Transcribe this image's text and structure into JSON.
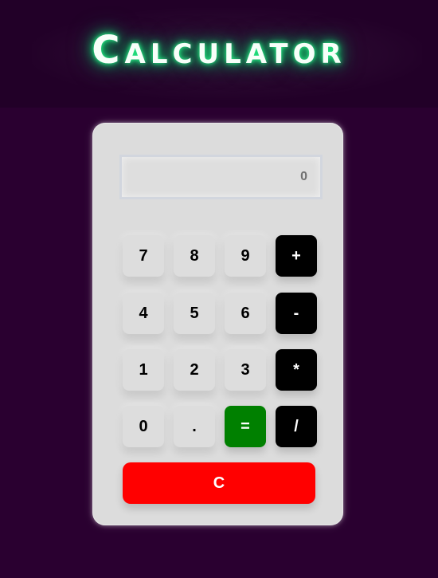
{
  "app": {
    "title": "Calculator"
  },
  "display": {
    "value": "0"
  },
  "buttons": {
    "row1": [
      "7",
      "8",
      "9",
      "+"
    ],
    "row2": [
      "4",
      "5",
      "6",
      "-"
    ],
    "row3": [
      "1",
      "2",
      "3",
      "*"
    ],
    "row4": [
      "0",
      ".",
      "=",
      "/"
    ],
    "clear": "C"
  },
  "colors": {
    "background": "#2a0030",
    "header_bg": "#220028",
    "title_glow": "#11d56d",
    "card": "#dcdcdc",
    "operator_button": "#000000",
    "equals_button": "#008000",
    "clear_button": "#ff0000"
  }
}
